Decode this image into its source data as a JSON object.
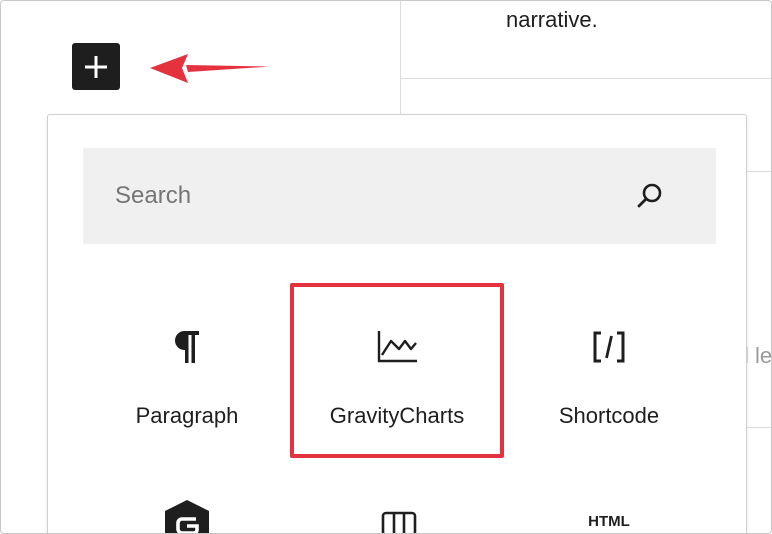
{
  "background": {
    "paragraph_fragment": "narrative.",
    "cut_text": "l le"
  },
  "inserter_toggle": {
    "icon": "plus-icon"
  },
  "search": {
    "placeholder": "Search",
    "value": ""
  },
  "blocks": [
    {
      "label": "Paragraph",
      "icon": "paragraph-icon"
    },
    {
      "label": "GravityCharts",
      "icon": "chart-line-icon"
    },
    {
      "label": "Shortcode",
      "icon": "shortcode-icon"
    }
  ],
  "blocks_row2": [
    {
      "label": "",
      "icon": "gravity-forms-icon"
    },
    {
      "label": "",
      "icon": "columns-icon"
    },
    {
      "label": "HTML",
      "icon": "html-icon"
    }
  ],
  "colors": {
    "highlight": "#e5323f",
    "arrow": "#e5323f",
    "toggle_bg": "#1e1e1e",
    "search_bg": "#f0f0f0"
  }
}
